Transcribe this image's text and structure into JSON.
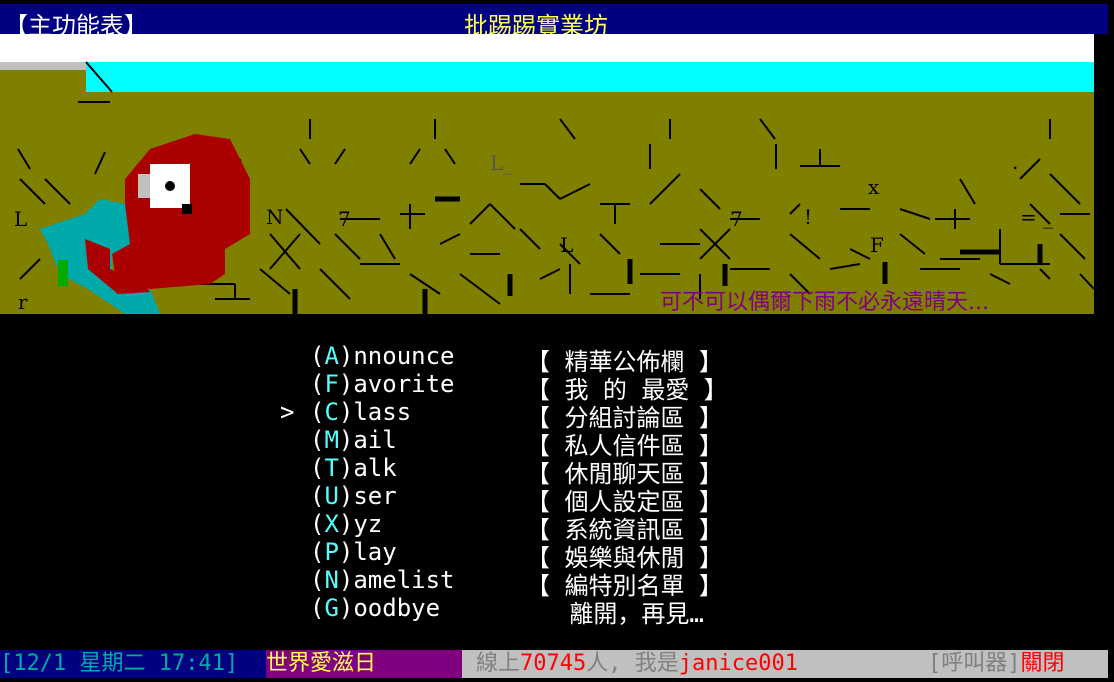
{
  "title_bar": {
    "section": "【主功能表】",
    "board_name": "批踢踢實業坊"
  },
  "banner": {
    "tagline": "可不可以偶爾下雨不必永遠晴天..."
  },
  "menu": {
    "cursor": ">",
    "selected_index": 2,
    "items": [
      {
        "key": "A",
        "rest": "nnounce",
        "desc": "【 精華公佈欄 】"
      },
      {
        "key": "F",
        "rest": "avorite",
        "desc": "【 我 的 最愛 】"
      },
      {
        "key": "C",
        "rest": "lass",
        "desc": "【 分組討論區 】"
      },
      {
        "key": "M",
        "rest": "ail",
        "desc": "【 私人信件區 】"
      },
      {
        "key": "T",
        "rest": "alk",
        "desc": "【 休閒聊天區 】"
      },
      {
        "key": "U",
        "rest": "ser",
        "desc": "【 個人設定區 】"
      },
      {
        "key": "X",
        "rest": "yz",
        "desc": "【 系統資訊區 】"
      },
      {
        "key": "P",
        "rest": "lay",
        "desc": "【 娛樂與休閒 】"
      },
      {
        "key": "N",
        "rest": "amelist",
        "desc": "【 編特別名單 】"
      },
      {
        "key": "G",
        "rest": "oodbye",
        "desc": "   離開，再見…"
      }
    ]
  },
  "status_bar": {
    "datetime": "[12/1 星期二 17:41]",
    "holiday": "世界愛滋日",
    "online_prefix": "線上",
    "online_count": "70745",
    "online_mid": "人, 我是",
    "username": "janice001",
    "pager_label": "[呼叫器]",
    "pager_state": "關閉"
  },
  "colors": {
    "title_bg": "#000080",
    "board_name": "#ffff55",
    "banner_olive": "#808000",
    "banner_cyan": "#00ffff",
    "parrot_red": "#aa0000",
    "parrot_teal": "#00aaaa",
    "menu_key": "#55ffff",
    "tagline": "#800080"
  }
}
